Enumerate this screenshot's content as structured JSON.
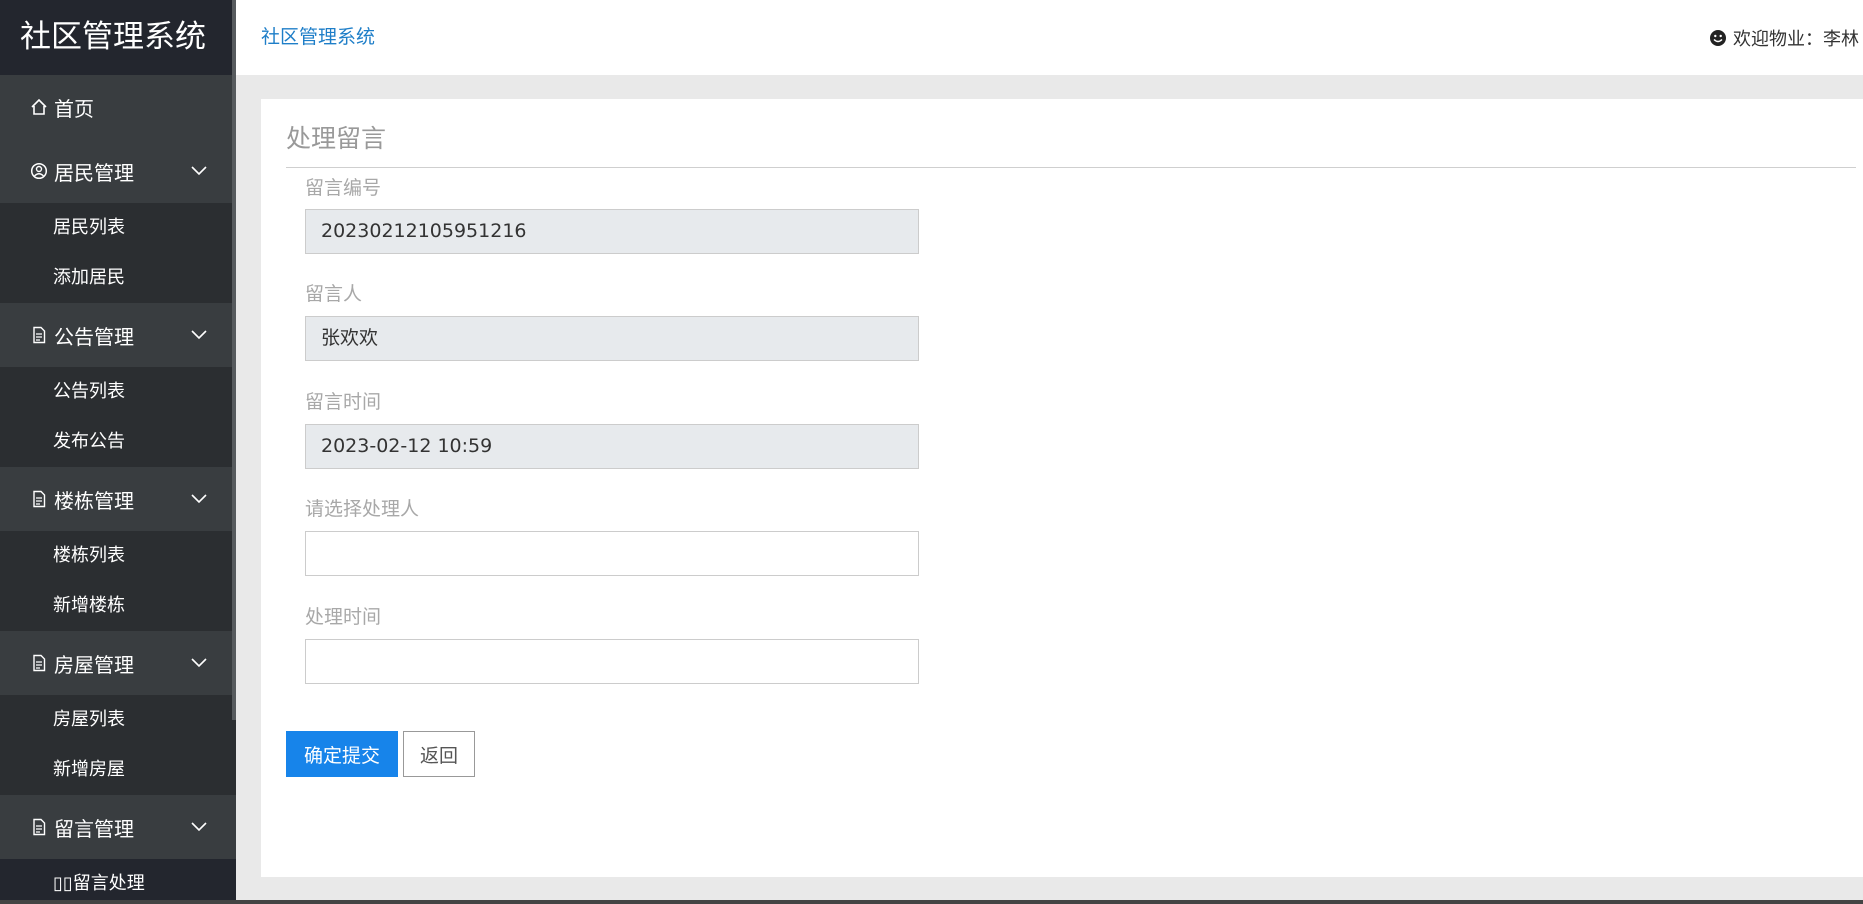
{
  "brand": "社区管理系统",
  "sidebar": {
    "home": "首页",
    "groups": [
      {
        "label": "居民管理",
        "items": [
          "居民列表",
          "添加居民"
        ]
      },
      {
        "label": "公告管理",
        "items": [
          "公告列表",
          "发布公告"
        ]
      },
      {
        "label": "楼栋管理",
        "items": [
          "楼栋列表",
          "新增楼栋"
        ]
      },
      {
        "label": "房屋管理",
        "items": [
          "房屋列表",
          "新增房屋"
        ]
      },
      {
        "label": "留言管理",
        "items": [
          "▯▯留言处理"
        ]
      }
    ]
  },
  "header": {
    "breadcrumb": "社区管理系统",
    "user": "欢迎物业：李林"
  },
  "form": {
    "title": "处理留言",
    "fields": [
      {
        "label": "留言编号",
        "value": "20230212105951216"
      },
      {
        "label": "留言人",
        "value": "张欢欢"
      },
      {
        "label": "留言时间",
        "value": "2023-02-12 10:59"
      },
      {
        "label": "请选择处理人",
        "value": ""
      },
      {
        "label": "处理时间",
        "value": ""
      }
    ],
    "submit": "确定提交",
    "back": "返回"
  }
}
